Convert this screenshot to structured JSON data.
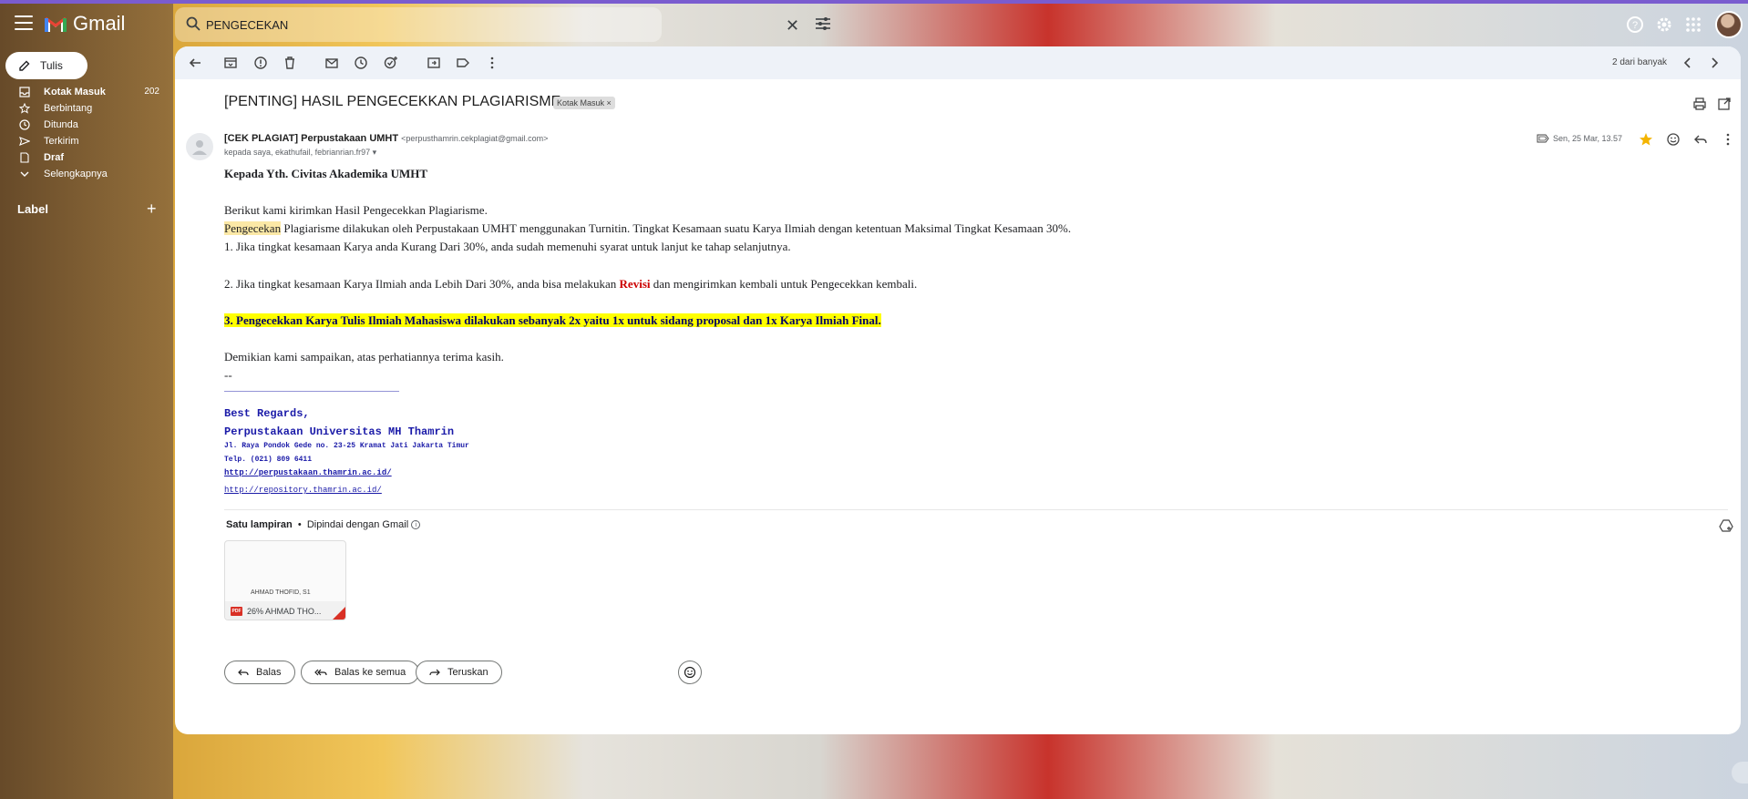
{
  "app": {
    "name": "Gmail"
  },
  "search": {
    "value": "PENGECEKAN"
  },
  "compose": {
    "label": "Tulis"
  },
  "sidebar": {
    "items": [
      {
        "label": "Kotak Masuk",
        "count": "202",
        "icon": "inbox-icon"
      },
      {
        "label": "Berbintang",
        "count": "",
        "icon": "star-icon"
      },
      {
        "label": "Ditunda",
        "count": "",
        "icon": "clock-icon"
      },
      {
        "label": "Terkirim",
        "count": "",
        "icon": "send-icon"
      },
      {
        "label": "Draf",
        "count": "",
        "icon": "draft-icon"
      },
      {
        "label": "Selengkapnya",
        "count": "",
        "icon": "chevron-down-icon"
      }
    ],
    "label_heading": "Label",
    "label_add": "+"
  },
  "toolbar": {
    "pager": "2 dari banyak"
  },
  "email": {
    "subject": "[PENTING] HASIL PENGECEKKAN PLAGIARISME",
    "tag": "Kotak Masuk",
    "tag_remove": "×",
    "sender_name": "[CEK PLAGIAT] Perpustakaan UMHT",
    "sender_email": "<perpusthamrin.cekplagiat@gmail.com>",
    "recipients": "kepada saya, ekathufail, febrianrian.fr97",
    "date": "Sen, 25 Mar, 13.57",
    "body": {
      "greeting": "Kepada Yth. Civitas Akademika UMHT",
      "p1": "Berikut kami kirimkan Hasil Pengecekkan Plagiarisme.",
      "p2_highlight": "Pengecekan",
      "p2_rest": " Plagiarisme dilakukan oleh Perpustakaan UMHT menggunakan Turnitin. Tingkat Kesamaan suatu Karya Ilmiah dengan ketentuan Maksimal Tingkat Kesamaan 30%.",
      "p3": "1. Jika tingkat kesamaan Karya anda Kurang Dari 30%, anda sudah memenuhi syarat untuk lanjut ke tahap selanjutnya.",
      "p4_a": "2. Jika tingkat kesamaan Karya Ilmiah anda Lebih Dari 30%, anda bisa melakukan ",
      "p4_revisi": "Revisi",
      "p4_b": " dan mengirimkan kembali untuk Pengecekkan kembali.",
      "p5": "3. Pengecekkan Karya Tulis Ilmiah Mahasiswa dilakukan sebanyak 2x yaitu 1x untuk sidang proposal dan 1x Karya Ilmiah Final.",
      "p6": "Demikian kami sampaikan, atas perhatiannya terima kasih.",
      "sig_dash": "--",
      "sig_line": "________________________________",
      "sig_regards": "Best Regards,",
      "sig_org": "Perpustakaan Universitas MH Thamrin",
      "sig_address": "Jl. Raya Pondok Gede no. 23-25 Kramat Jati Jakarta Timur",
      "sig_phone": "Telp. (021) 809 6411",
      "sig_link1": "http://perpustakaan.thamrin.ac.id/",
      "sig_link2": "http://repository.thamrin.ac.id/"
    },
    "attachments": {
      "title": "Satu lampiran",
      "separator": "•",
      "scanned": "Dipindai dengan Gmail",
      "file_preview": "AHMAD THOFID, S1",
      "file_name": "26% AHMAD THO...",
      "file_type": "PDF"
    }
  },
  "actions": {
    "reply": "Balas",
    "reply_all": "Balas ke semua",
    "forward": "Teruskan"
  },
  "colors": {
    "accent": "#7a5ccf",
    "highlight": "#ffff00",
    "revisi": "#cc0000",
    "sig": "#1a1aa8"
  }
}
